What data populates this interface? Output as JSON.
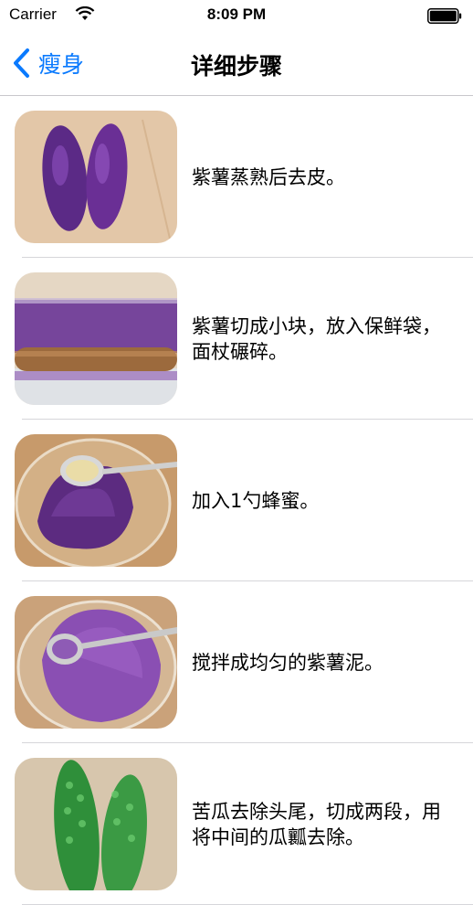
{
  "status_bar": {
    "carrier": "Carrier",
    "time": "8:09 PM"
  },
  "nav": {
    "back_label": "瘦身",
    "title": "详细步骤"
  },
  "steps": [
    {
      "text": "紫薯蒸熟后去皮。",
      "image": "purple-sweet-potatoes-peeled"
    },
    {
      "text": "紫薯切成小块，放入保鲜袋，\n面杖碾碎。",
      "image": "mashing-with-rolling-pin"
    },
    {
      "text": "加入1勺蜂蜜。",
      "image": "adding-honey-spoon"
    },
    {
      "text": "搅拌成均匀的紫薯泥。",
      "image": "stirred-purple-mash"
    },
    {
      "text": "苦瓜去除头尾，切成两段，用\n将中间的瓜瓤去除。",
      "image": "bitter-melons"
    }
  ],
  "colors": {
    "accent": "#0a7afe",
    "separator": "#c8c7cc"
  }
}
